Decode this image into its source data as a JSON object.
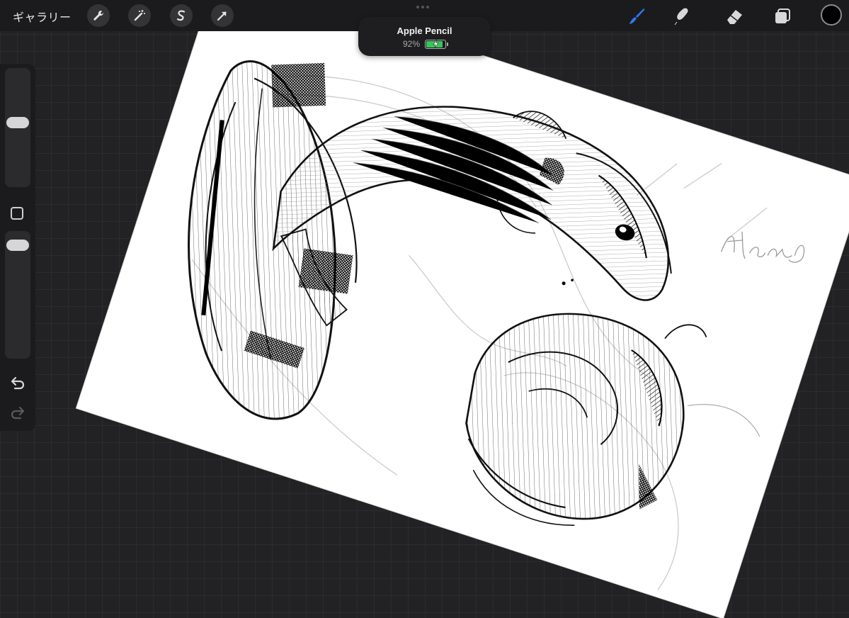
{
  "topbar": {
    "gallery_label": "ギャラリー",
    "left_tools": [
      "wrench-icon",
      "magic-wand-icon",
      "selection-icon",
      "transform-arrow-icon"
    ],
    "right_tools": [
      "brush-icon",
      "smudge-icon",
      "eraser-icon",
      "layers-icon"
    ],
    "active_tool": "brush-icon",
    "accent_color": "#2a7bff",
    "current_color": "#000000"
  },
  "pencil_popup": {
    "device_name": "Apple Pencil",
    "battery_percent": "92%",
    "battery_level": 0.92,
    "battery_color": "#35c759"
  },
  "sidebar": {
    "brush_size_level": 0.55,
    "opacity_level": 0.95,
    "undo_icon": "undo-arrow-icon",
    "redo_icon": "redo-arrow-icon"
  },
  "canvas": {
    "subject": "pencil sketch",
    "signature_text": "Hanako"
  }
}
